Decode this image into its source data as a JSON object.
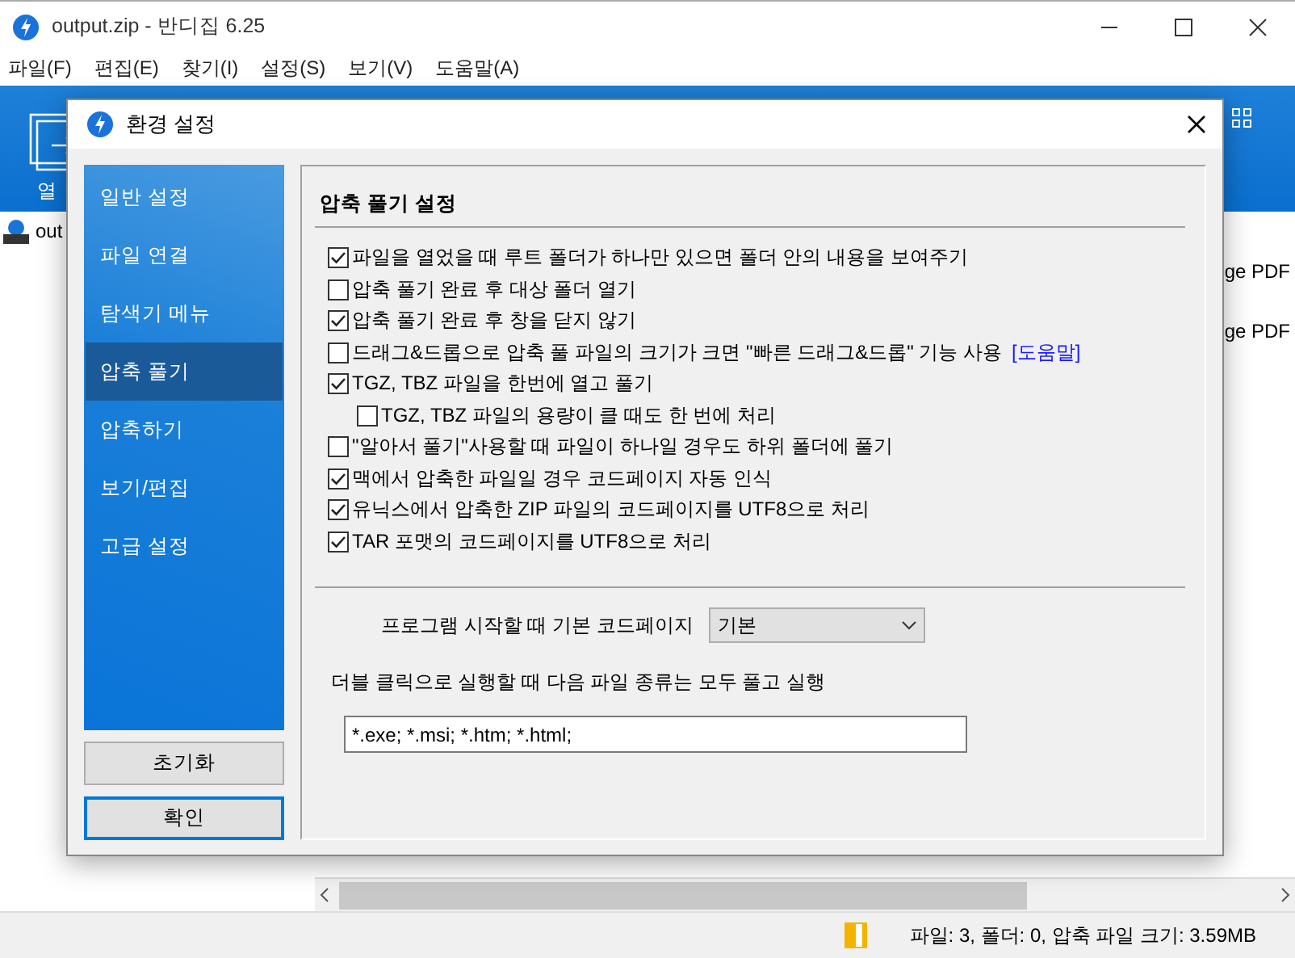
{
  "app": {
    "title": "output.zip - 반디집 6.25",
    "menu": [
      "파일(F)",
      "편집(E)",
      "찾기(I)",
      "설정(S)",
      "보기(V)",
      "도움말(A)"
    ],
    "toolbar_label": "열",
    "file_name": "out",
    "right_texts": [
      "ge PDF",
      "ge PDF"
    ],
    "status": "파일: 3, 폴더: 0, 압축 파일 크기: 3.59MB"
  },
  "dialog": {
    "title": "환경 설정",
    "nav": [
      {
        "label": "일반 설정",
        "selected": false
      },
      {
        "label": "파일 연결",
        "selected": false
      },
      {
        "label": "탐색기 메뉴",
        "selected": false
      },
      {
        "label": "압축 풀기",
        "selected": true
      },
      {
        "label": "압축하기",
        "selected": false
      },
      {
        "label": "보기/편집",
        "selected": false
      },
      {
        "label": "고급 설정",
        "selected": false
      }
    ],
    "buttons": [
      {
        "label": "초기화",
        "default": false
      },
      {
        "label": "확인",
        "default": true
      }
    ],
    "section_title": "압축 풀기 설정",
    "options": [
      {
        "label": "파일을 열었을 때 루트 폴더가 하나만 있으면 폴더 안의 내용을 보여주기",
        "checked": true
      },
      {
        "label": "압축 풀기 완료 후 대상 폴더 열기",
        "checked": false
      },
      {
        "label": "압축 풀기 완료 후 창을 닫지 않기",
        "checked": true
      },
      {
        "label": "드래그&드롭으로 압축 풀 파일의 크기가 크면 \"빠른 드래그&드롭\" 기능 사용",
        "checked": false,
        "link": "[도움말]"
      },
      {
        "label": "TGZ, TBZ 파일을 한번에 열고 풀기",
        "checked": true,
        "children": [
          {
            "label": "TGZ, TBZ 파일의 용량이 클 때도 한 번에 처리",
            "checked": false
          }
        ]
      },
      {
        "label": "\"알아서 풀기\"사용할 때 파일이 하나일 경우도 하위 폴더에 풀기",
        "checked": false
      },
      {
        "label": "맥에서 압축한 파일일 경우 코드페이지 자동 인식",
        "checked": true
      },
      {
        "label": "유닉스에서 압축한 ZIP 파일의 코드페이지를 UTF8으로 처리",
        "checked": true
      },
      {
        "label": "TAR 포맷의 코드페이지를 UTF8으로 처리",
        "checked": true
      }
    ],
    "codepage": {
      "label": "프로그램 시작할 때 기본 코드페이지",
      "value": "기본"
    },
    "exec": {
      "label": "더블 클릭으로 실행할 때 다음 파일 종류는 모두 풀고 실행",
      "value": "*.exe; *.msi; *.htm; *.html;"
    }
  }
}
